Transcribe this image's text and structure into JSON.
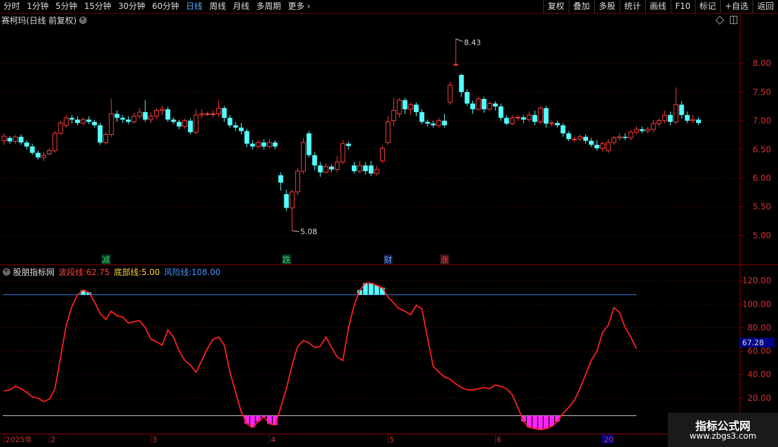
{
  "toolbar": {
    "periods": [
      "分时",
      "1分钟",
      "5分钟",
      "15分钟",
      "30分钟",
      "60分钟",
      "日线",
      "周线",
      "月线",
      "多周期",
      "更多"
    ],
    "active_period": "日线",
    "actions": [
      "复权",
      "叠加",
      "多股",
      "统计",
      "画线",
      "F10",
      "标记",
      "+自选",
      "返回"
    ]
  },
  "stock": {
    "title": "赛柯玛(日线 前复权)"
  },
  "main_chart": {
    "high_label": "8.43",
    "low_label": "5.08",
    "price_ticks": [
      "8.00",
      "7.50",
      "7.00",
      "6.50",
      "6.00",
      "5.50",
      "5.00"
    ],
    "price_tick_values": [
      8.0,
      7.5,
      7.0,
      6.5,
      6.0,
      5.5,
      5.0
    ],
    "markers": [
      {
        "text": "减",
        "color": "#4c4",
        "bg": "#033",
        "x_index": 18
      },
      {
        "text": "跌",
        "color": "#4c4",
        "bg": "#033",
        "x_index": 50
      },
      {
        "text": "财",
        "color": "#6af",
        "bg": "#113",
        "x_index": 68
      },
      {
        "text": "涨",
        "color": "#e44",
        "bg": "#311",
        "x_index": 78
      }
    ]
  },
  "indicator": {
    "name": "股朋指标网",
    "wave_label": "波段线:",
    "wave_value": "62.75",
    "bottom_label": "底部线:",
    "bottom_value": "5.00",
    "risk_label": "风险线:",
    "risk_value": "108.00",
    "current_value": "67.28",
    "ticks": [
      "120.00",
      "100.00",
      "80.00",
      "60.00",
      "40.00",
      "20.00"
    ],
    "tick_values": [
      120,
      100,
      80,
      60,
      40,
      20
    ]
  },
  "time_axis": {
    "labels": [
      "2025年",
      "2",
      "3",
      "4",
      "5",
      "6",
      "20"
    ],
    "label_index": [
      0,
      8,
      26,
      47,
      68,
      87,
      106
    ]
  },
  "watermark": {
    "title": "指标公式网",
    "site": "www.zbgs3.com"
  },
  "colors": {
    "up": "#ff3c3c",
    "down": "#55ffff",
    "wave": "#ff2020",
    "risk": "#3b7bd8",
    "bottom": "#d0d0d0",
    "bar": "#ff22ff"
  },
  "chart_data": {
    "type": "candlestick",
    "price_ylim": [
      4.5,
      8.65
    ],
    "indicator_ylim": [
      -10,
      133
    ],
    "candles": [
      [
        6.65,
        6.73,
        6.58,
        6.78
      ],
      [
        6.7,
        6.64,
        6.6,
        6.73
      ],
      [
        6.64,
        6.72,
        6.6,
        6.75
      ],
      [
        6.72,
        6.62,
        6.58,
        6.76
      ],
      [
        6.62,
        6.55,
        6.5,
        6.66
      ],
      [
        6.55,
        6.44,
        6.4,
        6.6
      ],
      [
        6.44,
        6.36,
        6.32,
        6.48
      ],
      [
        6.36,
        6.4,
        6.3,
        6.46
      ],
      [
        6.42,
        6.48,
        6.4,
        6.52
      ],
      [
        6.48,
        6.78,
        6.44,
        6.82
      ],
      [
        6.78,
        6.96,
        6.75,
        7.0
      ],
      [
        6.92,
        7.05,
        6.88,
        7.1
      ],
      [
        7.05,
        7.02,
        6.95,
        7.1
      ],
      [
        7.02,
        6.96,
        6.92,
        7.08
      ],
      [
        6.96,
        7.02,
        6.92,
        7.06
      ],
      [
        7.02,
        6.98,
        6.94,
        7.08
      ],
      [
        6.98,
        6.92,
        6.88,
        7.02
      ],
      [
        6.92,
        6.62,
        6.58,
        6.96
      ],
      [
        6.62,
        6.76,
        6.58,
        6.8
      ],
      [
        6.76,
        7.12,
        6.72,
        7.38
      ],
      [
        7.12,
        7.05,
        6.98,
        7.18
      ],
      [
        7.05,
        7.02,
        6.96,
        7.1
      ],
      [
        7.02,
        6.98,
        6.94,
        7.08
      ],
      [
        6.98,
        7.08,
        6.95,
        7.14
      ],
      [
        7.08,
        7.15,
        7.04,
        7.22
      ],
      [
        7.15,
        7.02,
        6.98,
        7.36
      ],
      [
        7.02,
        7.08,
        6.96,
        7.14
      ],
      [
        7.08,
        7.18,
        7.02,
        7.22
      ],
      [
        7.18,
        7.2,
        7.1,
        7.26
      ],
      [
        7.2,
        7.02,
        6.98,
        7.24
      ],
      [
        7.02,
        6.98,
        6.94,
        7.06
      ],
      [
        6.98,
        6.9,
        6.85,
        7.02
      ],
      [
        6.9,
        7.0,
        6.86,
        7.04
      ],
      [
        7.0,
        6.8,
        6.76,
        7.04
      ],
      [
        6.8,
        7.1,
        6.76,
        7.2
      ],
      [
        7.1,
        7.12,
        7.04,
        7.2
      ],
      [
        7.12,
        7.12,
        7.08,
        7.16
      ],
      [
        7.12,
        7.12,
        7.06,
        7.18
      ],
      [
        7.12,
        7.22,
        7.06,
        7.36
      ],
      [
        7.22,
        7.05,
        6.98,
        7.26
      ],
      [
        7.05,
        6.92,
        6.88,
        7.1
      ],
      [
        6.92,
        6.88,
        6.82,
        6.98
      ],
      [
        6.88,
        6.82,
        6.76,
        6.96
      ],
      [
        6.82,
        6.6,
        6.54,
        6.86
      ],
      [
        6.6,
        6.55,
        6.5,
        6.66
      ],
      [
        6.55,
        6.62,
        6.52,
        6.66
      ],
      [
        6.62,
        6.55,
        6.5,
        6.68
      ],
      [
        6.55,
        6.62,
        6.52,
        6.68
      ],
      [
        6.62,
        6.55,
        6.5,
        6.66
      ],
      [
        6.05,
        5.92,
        5.78,
        6.1
      ],
      [
        5.72,
        5.48,
        5.42,
        5.8
      ],
      [
        5.48,
        5.76,
        5.08,
        5.8
      ],
      [
        5.76,
        6.12,
        5.7,
        6.18
      ],
      [
        6.12,
        6.62,
        6.08,
        6.7
      ],
      [
        6.78,
        6.4,
        6.36,
        6.82
      ],
      [
        6.4,
        6.22,
        6.14,
        6.46
      ],
      [
        6.22,
        6.1,
        6.02,
        6.28
      ],
      [
        6.1,
        6.2,
        6.08,
        6.26
      ],
      [
        6.2,
        6.15,
        6.1,
        6.24
      ],
      [
        6.15,
        6.28,
        6.1,
        6.38
      ],
      [
        6.28,
        6.6,
        6.24,
        6.66
      ],
      [
        6.6,
        6.56,
        6.5,
        6.64
      ],
      [
        6.22,
        6.12,
        6.08,
        6.28
      ],
      [
        6.12,
        6.22,
        6.08,
        6.3
      ],
      [
        6.22,
        6.12,
        6.06,
        6.28
      ],
      [
        6.22,
        6.08,
        6.04,
        6.3
      ],
      [
        6.08,
        6.15,
        6.04,
        6.22
      ],
      [
        6.3,
        6.52,
        6.26,
        6.56
      ],
      [
        6.62,
        6.98,
        6.58,
        7.08
      ],
      [
        7.0,
        7.18,
        6.9,
        7.4
      ],
      [
        7.12,
        7.36,
        7.06,
        7.4
      ],
      [
        7.36,
        7.2,
        7.12,
        7.4
      ],
      [
        7.2,
        7.28,
        7.1,
        7.32
      ],
      [
        7.28,
        7.15,
        7.08,
        7.32
      ],
      [
        7.15,
        6.98,
        6.94,
        7.2
      ],
      [
        6.98,
        6.95,
        6.9,
        7.02
      ],
      [
        6.95,
        6.92,
        6.88,
        7.0
      ],
      [
        6.92,
        7.0,
        6.88,
        7.05
      ],
      [
        7.0,
        6.92,
        6.88,
        7.12
      ],
      [
        7.32,
        7.62,
        7.28,
        7.68
      ],
      [
        7.98,
        7.98,
        7.95,
        8.43
      ],
      [
        7.8,
        7.5,
        7.42,
        7.82
      ],
      [
        7.5,
        7.3,
        7.26,
        7.55
      ],
      [
        7.3,
        7.2,
        7.12,
        7.35
      ],
      [
        7.2,
        7.38,
        7.18,
        7.42
      ],
      [
        7.38,
        7.2,
        7.14,
        7.42
      ],
      [
        7.2,
        7.3,
        7.18,
        7.34
      ],
      [
        7.3,
        7.25,
        7.18,
        7.34
      ],
      [
        7.25,
        7.05,
        7.0,
        7.3
      ],
      [
        7.05,
        6.95,
        6.92,
        7.1
      ],
      [
        6.95,
        7.05,
        6.92,
        7.1
      ],
      [
        7.05,
        7.06,
        7.0,
        7.1
      ],
      [
        7.06,
        7.02,
        6.96,
        7.1
      ],
      [
        7.02,
        7.1,
        6.98,
        7.16
      ],
      [
        7.1,
        6.98,
        6.92,
        7.18
      ],
      [
        6.98,
        7.22,
        6.94,
        7.26
      ],
      [
        7.22,
        6.95,
        6.88,
        7.26
      ],
      [
        6.95,
        6.96,
        6.9,
        7.0
      ],
      [
        6.96,
        6.92,
        6.88,
        7.0
      ],
      [
        6.92,
        6.78,
        6.72,
        6.96
      ],
      [
        6.78,
        6.68,
        6.64,
        6.82
      ],
      [
        6.68,
        6.68,
        6.62,
        6.72
      ],
      [
        6.68,
        6.72,
        6.64,
        6.76
      ],
      [
        6.72,
        6.65,
        6.6,
        6.76
      ],
      [
        6.65,
        6.58,
        6.54,
        6.7
      ],
      [
        6.58,
        6.52,
        6.48,
        6.66
      ],
      [
        6.52,
        6.6,
        6.46,
        6.64
      ],
      [
        6.48,
        6.62,
        6.44,
        6.68
      ],
      [
        6.62,
        6.7,
        6.58,
        6.74
      ],
      [
        6.7,
        6.72,
        6.66,
        6.78
      ],
      [
        6.72,
        6.7,
        6.66,
        6.78
      ],
      [
        6.7,
        6.8,
        6.66,
        6.84
      ],
      [
        6.8,
        6.85,
        6.76,
        6.9
      ],
      [
        6.85,
        6.82,
        6.78,
        6.9
      ],
      [
        6.82,
        6.85,
        6.78,
        6.9
      ],
      [
        6.85,
        6.95,
        6.8,
        7.02
      ],
      [
        6.95,
        7.0,
        6.9,
        7.04
      ],
      [
        7.0,
        7.1,
        6.95,
        7.18
      ],
      [
        7.1,
        6.98,
        6.92,
        7.16
      ],
      [
        6.98,
        7.28,
        6.94,
        7.58
      ],
      [
        7.28,
        7.1,
        7.04,
        7.34
      ],
      [
        7.1,
        7.0,
        6.96,
        7.16
      ],
      [
        7.0,
        7.02,
        6.96,
        7.1
      ],
      [
        7.02,
        6.96,
        6.92,
        7.06
      ]
    ],
    "wave": [
      26,
      27,
      30,
      28,
      25,
      21,
      20,
      17,
      19,
      28,
      55,
      82,
      98,
      108,
      112,
      110,
      102,
      92,
      87,
      94,
      90,
      89,
      84,
      85,
      86,
      80,
      70,
      68,
      65,
      78,
      72,
      60,
      52,
      48,
      42,
      52,
      62,
      70,
      72,
      65,
      42,
      25,
      8,
      -2,
      -5,
      0,
      4,
      -2,
      -3,
      12,
      28,
      48,
      64,
      69,
      67,
      63,
      64,
      72,
      63,
      55,
      52,
      80,
      99,
      112,
      118,
      118,
      116,
      114,
      106,
      101,
      96,
      94,
      91,
      99,
      96,
      71,
      47,
      42,
      38,
      36,
      32,
      29,
      27,
      27,
      28,
      29,
      28,
      31,
      30,
      28,
      23,
      12,
      0,
      -5,
      -6,
      -7,
      -6,
      -4,
      0,
      7,
      12,
      18,
      28,
      40,
      52,
      60,
      76,
      82,
      97,
      93,
      80,
      72,
      62
    ]
  }
}
